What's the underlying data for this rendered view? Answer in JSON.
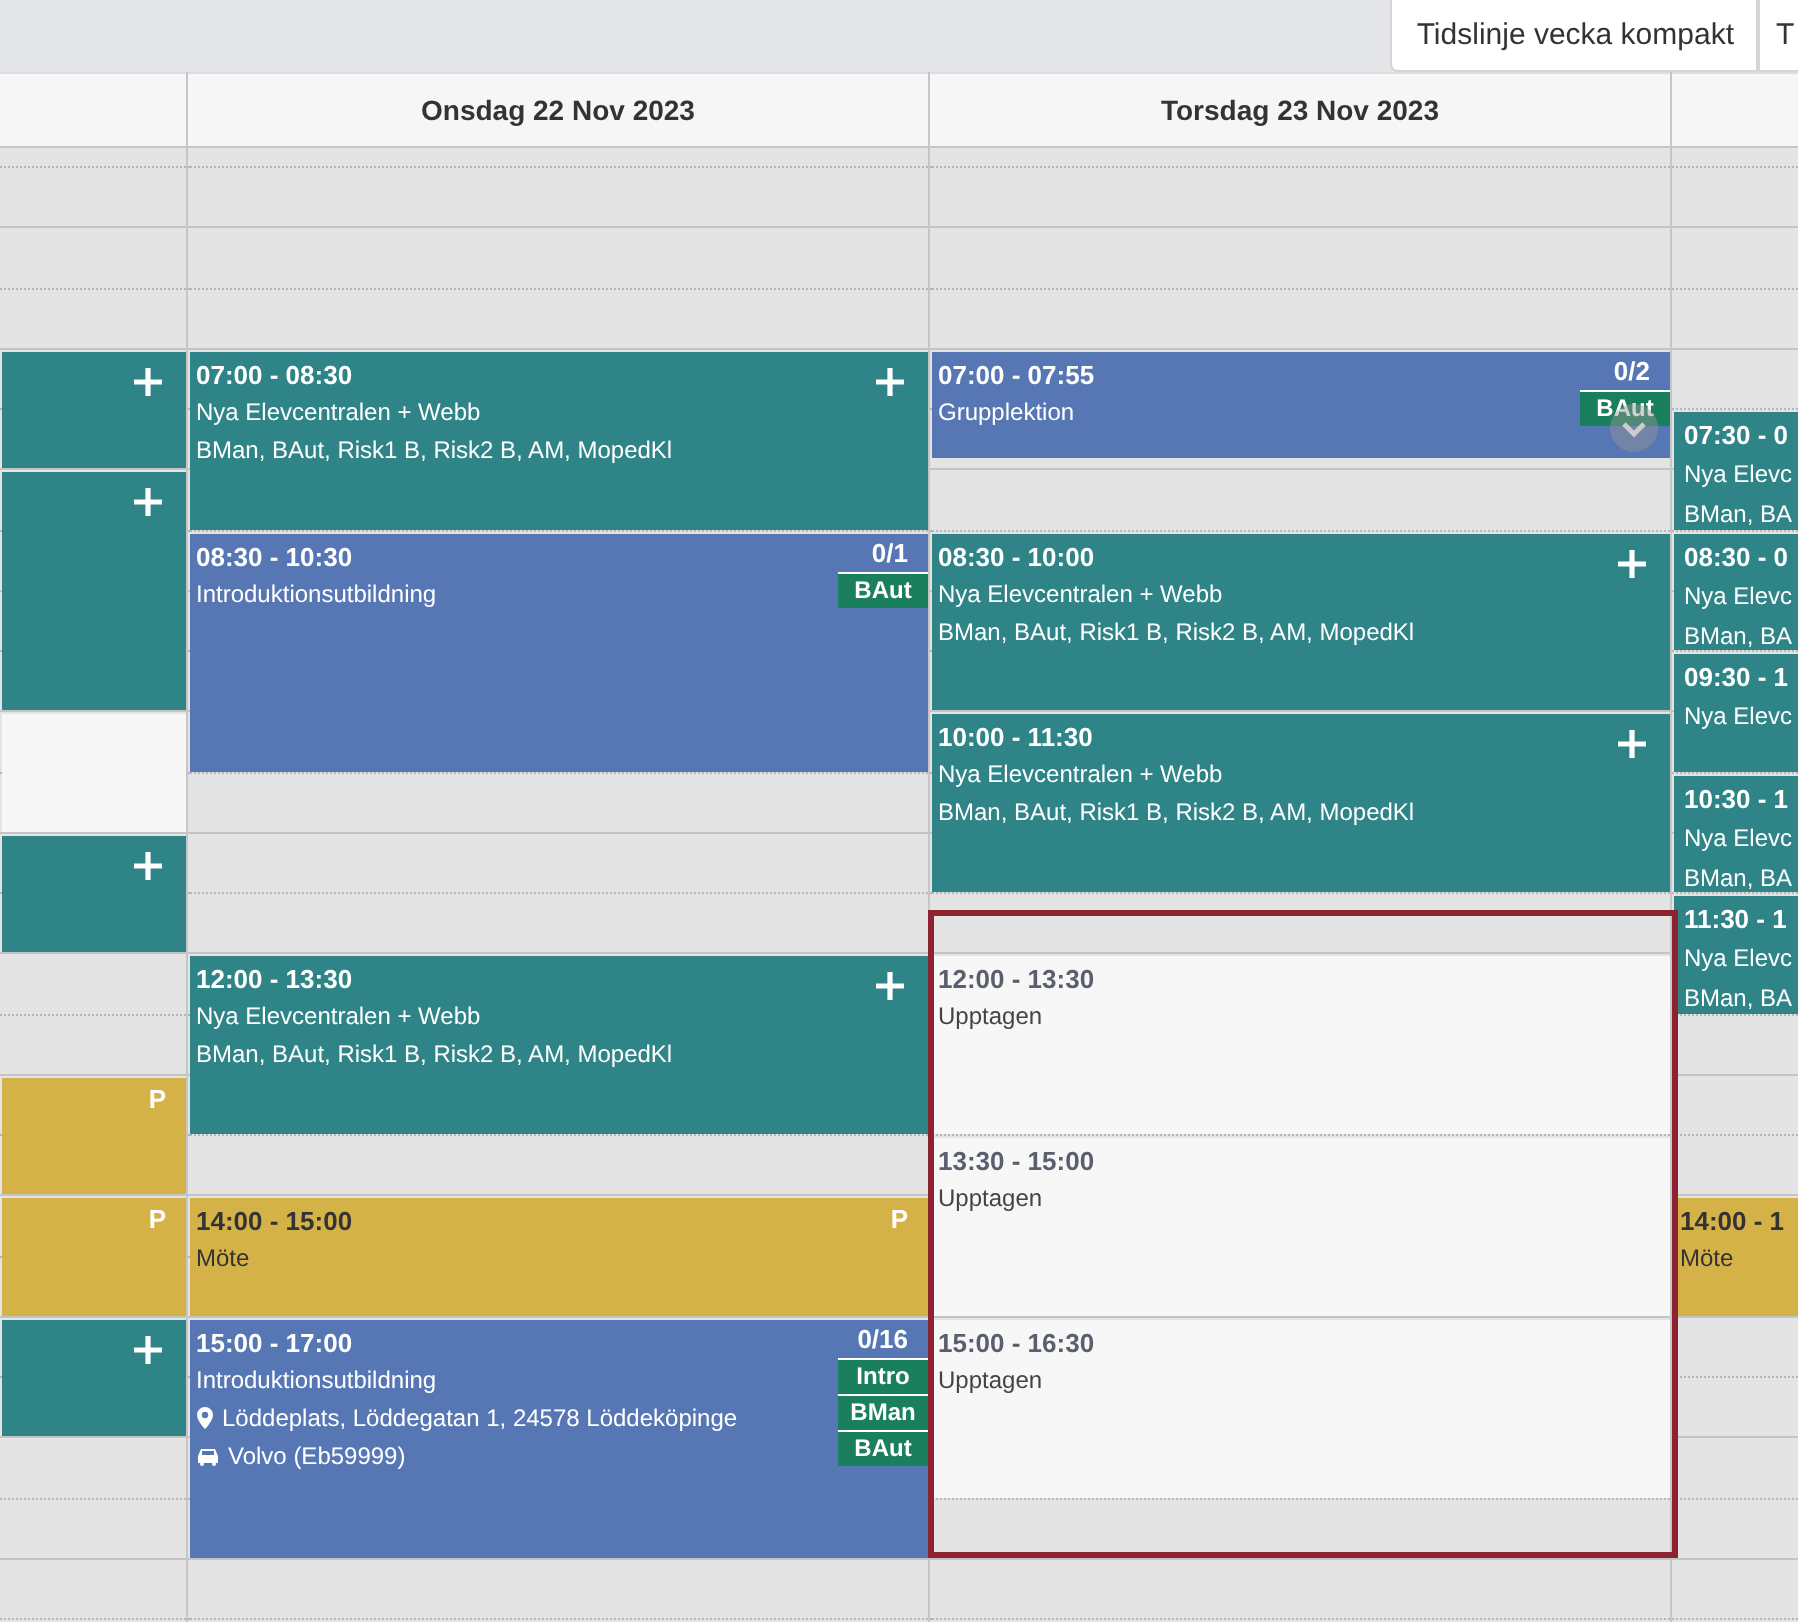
{
  "toolbar": {
    "buttons": [
      {
        "label": "Tidslinje vecka kompakt"
      },
      {
        "label": "T"
      }
    ]
  },
  "columns": [
    {
      "events": [
        {
          "kind": "open"
        },
        {
          "kind": "open"
        },
        {
          "kind": "free"
        },
        {
          "kind": "open"
        },
        {
          "kind": "personal",
          "marker": "P"
        },
        {
          "kind": "personal",
          "marker": "P"
        },
        {
          "kind": "open"
        }
      ]
    },
    {
      "heading": "Onsdag 22 Nov 2023",
      "events": [
        {
          "kind": "open",
          "time": "07:00 - 08:30",
          "title": "Nya Elevcentralen + Webb",
          "details": "BMan, BAut, Risk1 B, Risk2 B, AM, MopedKl"
        },
        {
          "kind": "lesson",
          "time": "08:30 - 10:30",
          "title": "Introduktionsutbildning",
          "count": "0/1",
          "tags": [
            "BAut"
          ]
        },
        {
          "kind": "open",
          "time": "12:00 - 13:30",
          "title": "Nya Elevcentralen + Webb",
          "details": "BMan, BAut, Risk1 B, Risk2 B, AM, MopedKl"
        },
        {
          "kind": "personal",
          "time": "14:00 - 15:00",
          "title": "Möte",
          "marker": "P"
        },
        {
          "kind": "lesson",
          "time": "15:00 - 17:00",
          "title": "Introduktionsutbildning",
          "location": "Löddeplats, Löddegatan 1, 24578 Löddeköpinge",
          "vehicle": "Volvo (Eb59999)",
          "count": "0/16",
          "tags": [
            "Intro",
            "BMan",
            "BAut"
          ]
        }
      ]
    },
    {
      "heading": "Torsdag 23 Nov 2023",
      "events": [
        {
          "kind": "lesson",
          "time": "07:00 - 07:55",
          "title": "Grupplektion",
          "count": "0/2",
          "tags": [
            "BAut"
          ],
          "expandable": true
        },
        {
          "kind": "open",
          "time": "08:30 - 10:00",
          "title": "Nya Elevcentralen + Webb",
          "details": "BMan, BAut, Risk1 B, Risk2 B, AM, MopedKl"
        },
        {
          "kind": "open",
          "time": "10:00 - 11:30",
          "title": "Nya Elevcentralen + Webb",
          "details": "BMan, BAut, Risk1 B, Risk2 B, AM, MopedKl"
        },
        {
          "kind": "busy",
          "time": "12:00 - 13:30",
          "title": "Upptagen"
        },
        {
          "kind": "busy",
          "time": "13:30 - 15:00",
          "title": "Upptagen"
        },
        {
          "kind": "busy",
          "time": "15:00 - 16:30",
          "title": "Upptagen"
        }
      ]
    },
    {
      "events": [
        {
          "kind": "open-cut",
          "time": "07:30 - 0",
          "title": "Nya Elevc",
          "details": "BMan, BA"
        },
        {
          "kind": "open-cut",
          "time": "08:30 - 0",
          "title": "Nya Elevc",
          "details": "BMan, BA"
        },
        {
          "kind": "open-cut",
          "time": "09:30 - 1",
          "title": "Nya Elevc"
        },
        {
          "kind": "open-cut",
          "time": "10:30 - 1",
          "title": "Nya Elevc",
          "details": "BMan, BA"
        },
        {
          "kind": "open-cut",
          "time": "11:30 - 1",
          "title": "Nya Elevc",
          "details": "BMan, BA"
        },
        {
          "kind": "personal",
          "time": "14:00 - 1",
          "title": "Möte"
        }
      ]
    }
  ]
}
